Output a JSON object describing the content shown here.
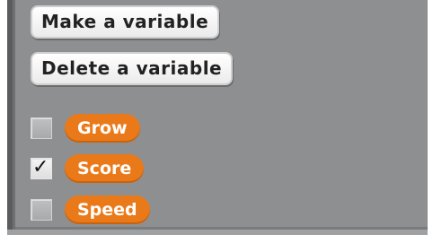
{
  "buttons": {
    "make_variable": "Make a variable",
    "delete_variable": "Delete a variable"
  },
  "variables": [
    {
      "name": "Grow",
      "checked": false
    },
    {
      "name": "Score",
      "checked": true
    },
    {
      "name": "Speed",
      "checked": false
    }
  ],
  "check_glyph": "✓",
  "colors": {
    "panel": "#8e8f91",
    "variable_block": "#ea7a19"
  }
}
